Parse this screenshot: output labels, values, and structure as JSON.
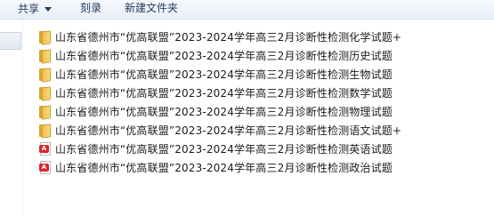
{
  "toolbar": {
    "share_label": "共享",
    "burn_label": "刻录",
    "new_folder_label": "新建文件夹"
  },
  "files": [
    {
      "type": "folder",
      "icon": "folder-icon",
      "name": "山东省德州市“优高联盟”2023-2024学年高三2月诊断性检测化学试题+"
    },
    {
      "type": "folder",
      "icon": "folder-icon",
      "name": "山东省德州市“优高联盟”2023-2024学年高三2月诊断性检测历史试题"
    },
    {
      "type": "folder",
      "icon": "folder-icon",
      "name": "山东省德州市“优高联盟”2023-2024学年高三2月诊断性检测生物试题"
    },
    {
      "type": "folder",
      "icon": "folder-icon",
      "name": "山东省德州市“优高联盟”2023-2024学年高三2月诊断性检测数学试题"
    },
    {
      "type": "folder",
      "icon": "folder-icon",
      "name": "山东省德州市“优高联盟”2023-2024学年高三2月诊断性检测物理试题"
    },
    {
      "type": "folder",
      "icon": "folder-icon",
      "name": "山东省德州市“优高联盟”2023-2024学年高三2月诊断性检测语文试题+"
    },
    {
      "type": "pdf",
      "icon": "pdf-icon",
      "name": "山东省德州市“优高联盟”2023-2024学年高三2月诊断性检测英语试题"
    },
    {
      "type": "pdf",
      "icon": "pdf-icon",
      "name": "山东省德州市“优高联盟”2023-2024学年高三2月诊断性检测政治试题"
    }
  ]
}
